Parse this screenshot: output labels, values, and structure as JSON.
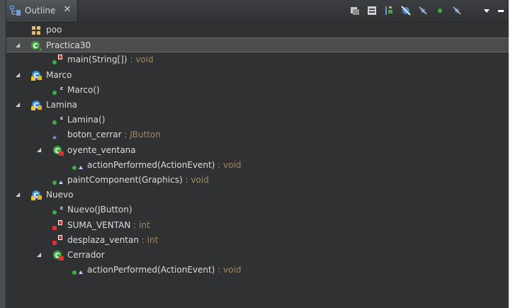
{
  "view": {
    "tab_title": "Outline",
    "tab_icon": "outline-icon",
    "close_symbol": "✕",
    "toolbar_icons": [
      "hide-fields-icon",
      "hide-static-icon",
      "hide-nonpublic-icon",
      "hide-local-types-icon",
      "link-editor-icon",
      "focus-icon",
      "filter-icon",
      "view-menu-icon",
      "minimize-icon"
    ]
  },
  "tree": [
    {
      "label": "poo",
      "type": "",
      "indent": 0,
      "twisty": "",
      "icon": "package-icon"
    },
    {
      "label": "Practica30",
      "type": "",
      "indent": 0,
      "twisty": "◢",
      "icon": "public-class-icon",
      "selected": true
    },
    {
      "label": "main(String[])",
      "type": "void",
      "indent": 1,
      "twisty": "",
      "icon": "public-static-method-icon"
    },
    {
      "label": "Marco",
      "type": "",
      "indent": 0,
      "twisty": "◢",
      "icon": "default-class-icon"
    },
    {
      "label": "Marco()",
      "type": "",
      "indent": 1,
      "twisty": "",
      "icon": "constructor-icon"
    },
    {
      "label": "Lamina",
      "type": "",
      "indent": 0,
      "twisty": "◢",
      "icon": "default-class-icon"
    },
    {
      "label": "Lamina()",
      "type": "",
      "indent": 1,
      "twisty": "",
      "icon": "constructor-icon"
    },
    {
      "label": "boton_cerrar",
      "type": "JButton",
      "indent": 1,
      "twisty": "",
      "icon": "default-field-icon"
    },
    {
      "label": "oyente_ventana",
      "type": "",
      "indent": 1,
      "twisty": "◢",
      "icon": "private-inner-class-icon"
    },
    {
      "label": "actionPerformed(ActionEvent)",
      "type": "void",
      "indent": 2,
      "twisty": "",
      "icon": "override-method-icon"
    },
    {
      "label": "paintComponent(Graphics)",
      "type": "void",
      "indent": 1,
      "twisty": "",
      "icon": "override-method-icon"
    },
    {
      "label": "Nuevo",
      "type": "",
      "indent": 0,
      "twisty": "◢",
      "icon": "default-class-icon"
    },
    {
      "label": "Nuevo(JButton)",
      "type": "",
      "indent": 1,
      "twisty": "",
      "icon": "constructor-icon"
    },
    {
      "label": "SUMA_VENTAN",
      "type": "int",
      "indent": 1,
      "twisty": "",
      "icon": "private-static-final-field-icon"
    },
    {
      "label": "desplaza_ventan",
      "type": "int",
      "indent": 1,
      "twisty": "",
      "icon": "private-static-field-icon"
    },
    {
      "label": "Cerrador",
      "type": "",
      "indent": 1,
      "twisty": "◢",
      "icon": "private-inner-class-icon"
    },
    {
      "label": "actionPerformed(ActionEvent)",
      "type": "void",
      "indent": 2,
      "twisty": "",
      "icon": "override-method-icon"
    }
  ]
}
